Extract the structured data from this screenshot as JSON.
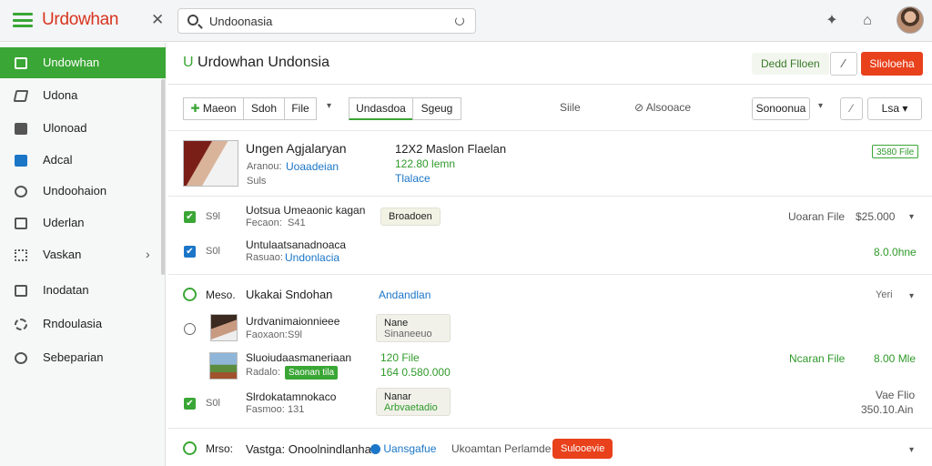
{
  "app": {
    "title": "Urdowhan",
    "search_value": "Undoonasia"
  },
  "colors": {
    "accent": "#3aa635",
    "danger": "#e8411c",
    "brand_text": "#d8341f",
    "link": "#1b76c8"
  },
  "topbar_icons": [
    "menu-icon",
    "close-icon",
    "search-icon",
    "refresh-icon",
    "puzzle-icon",
    "home-icon",
    "avatar"
  ],
  "sidebar": {
    "items": [
      {
        "label": "Undowhan",
        "icon": "grid-icon",
        "active": true
      },
      {
        "label": "Udona",
        "icon": "edit-icon"
      },
      {
        "label": "Ulonoad",
        "icon": "chart-icon"
      },
      {
        "label": "Adcal",
        "icon": "folder-icon"
      },
      {
        "label": "Undoohaion",
        "icon": "location-icon"
      },
      {
        "label": "Uderlan",
        "icon": "square-icon"
      },
      {
        "label": "Vaskan",
        "icon": "list-icon",
        "has_children": true
      },
      {
        "label": "Inodatan",
        "icon": "document-icon"
      },
      {
        "label": "Rndoulasia",
        "icon": "gear-icon"
      },
      {
        "label": "Sebeparian",
        "icon": "settings-icon"
      }
    ]
  },
  "header": {
    "title_prefix": "U",
    "title": "Urdowhan Undonsia",
    "ghost_button": "Dedd Flloen",
    "edit_label": "⁄",
    "danger_button": "Slioloeha"
  },
  "toolbar": {
    "seg1": [
      "Maeon",
      "Sdoh",
      "File"
    ],
    "seg2": [
      "Undasdoa",
      "Sgeug"
    ],
    "plain1": "Siile",
    "plain2": "Alsooace",
    "select_label": "Sonoonua",
    "edit_label": "⁄",
    "last_select": "Lsa"
  },
  "rows": {
    "r1": {
      "name": "Ungen Agjalaryan",
      "sub_label": "Aranou:",
      "sub_value": "Uoaadeian",
      "sub2": "Suls",
      "mid_title": "12X2 Maslon Flaelan",
      "mid_green": "122.80 lemn",
      "mid_blue": "Tlalace",
      "badge": "3580 File"
    },
    "r2": {
      "check": "✔",
      "id": "S9l",
      "title": "Uotsua Umeaonic kagan",
      "sub_label": "Fecaon:",
      "sub_value": "S41",
      "tag": "Broadoen",
      "right_label": "Uoaran File",
      "right_value": "$25.000"
    },
    "r3": {
      "check": "✔",
      "id": "S0l",
      "title": "Untulaatsanadnoaca",
      "sub_label": "Rasuao:",
      "sub_value": "Undonlacia",
      "right_green": "8.0.0hne"
    },
    "group": {
      "prefix": "Meso.",
      "title": "Ukakai Sndohan",
      "link": "Andandlan",
      "right": "Yeri"
    },
    "g1": {
      "title": "Urdvanimaionnieee",
      "sub_label": "Faoxaon:",
      "sub_value": "S9l",
      "tag_title": "Nane",
      "tag_sub": "Sinaneeuo"
    },
    "g2": {
      "title": "Sluoiudaasmaneriaan",
      "sub_label": "Radalo:",
      "pill": "Saonan tila",
      "mid_green1": "120 File",
      "mid_green2": "164 0.580.000",
      "right_label": "Ncaran File",
      "right_value": "8.00 Mle"
    },
    "g3": {
      "check": "✔",
      "id": "S0l",
      "title": "Slrdokatamnokaco",
      "sub_label": "Fasmoo:",
      "sub_value": "131",
      "tag_title": "Nanar",
      "tag_sub": "Arbvaetadio",
      "right1": "Vae Flio",
      "right2": "350.10.Ain"
    },
    "last": {
      "prefix": "Mrso:",
      "title": "Vastga: Onoolnindlanha",
      "link": "Uansgafue",
      "text": "Ukoamtan Perlamde",
      "button": "Sulooevie"
    }
  }
}
